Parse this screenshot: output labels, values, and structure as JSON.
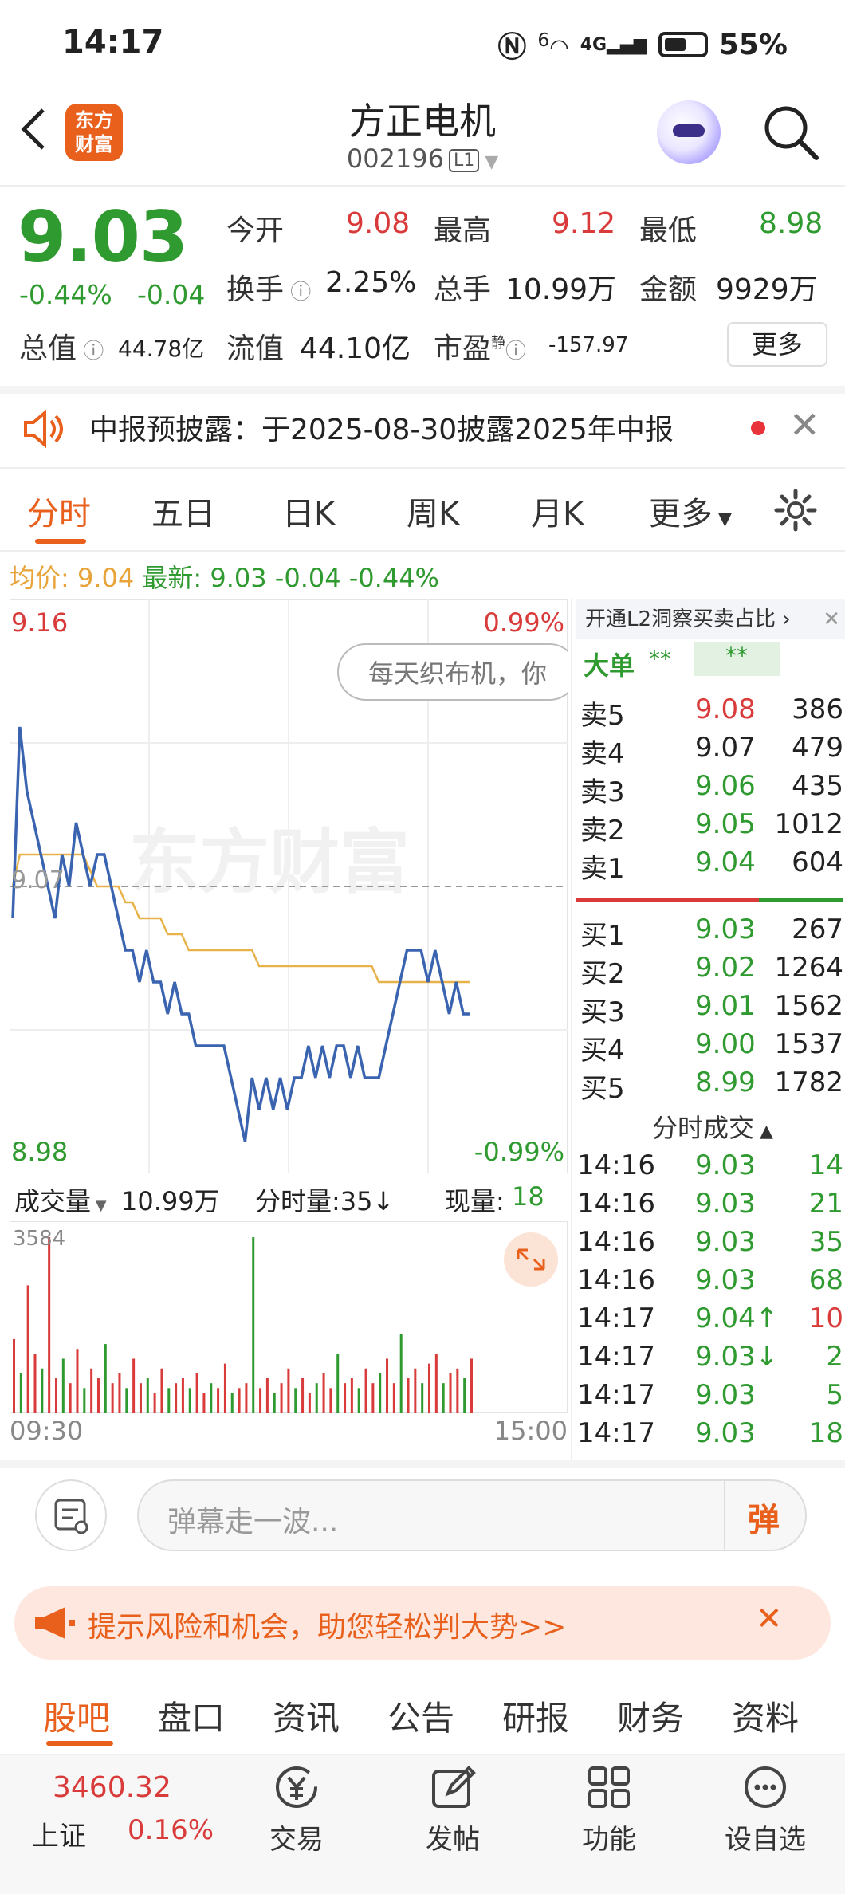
{
  "status_bar": {
    "time": "14:17",
    "signal_label": "6",
    "network": "4G",
    "battery": "55%"
  },
  "header": {
    "back_label": "<",
    "logo_text_1": "东方",
    "logo_text_2": "财富",
    "stock_name": "方正电机",
    "stock_code": "002196",
    "level": "L1"
  },
  "quote": {
    "price": "9.03",
    "change_pct": "-0.44%",
    "change": "-0.04",
    "open_label": "今开",
    "open": "9.08",
    "high_label": "最高",
    "high": "9.12",
    "low_label": "最低",
    "low": "8.98",
    "turnover_label": "换手",
    "turnover": "2.25%",
    "volume_label": "总手",
    "volume": "10.99万",
    "amount_label": "金额",
    "amount": "9929万",
    "mktcap_label": "总值",
    "mktcap": "44.78亿",
    "float_label": "流值",
    "float": "44.10亿",
    "pe_label": "市盈",
    "pe_sup": "静",
    "pe": "-157.97",
    "more_label": "更多"
  },
  "notice": {
    "text": "中报预披露：于2025-08-30披露2025年中报"
  },
  "chart_tabs": [
    "分时",
    "五日",
    "日K",
    "周K",
    "月K",
    "更多"
  ],
  "avg_line": {
    "avg_label": "均价:",
    "avg": "9.04",
    "latest_label": "最新:",
    "latest": "9.03",
    "chg": "-0.04",
    "pct": "-0.44%"
  },
  "chart_labels": {
    "ymax": "9.16",
    "ymin": "8.98",
    "pmax": "0.99%",
    "pmin": "-0.99%",
    "baseline": "9.07",
    "watermark": "东方财富",
    "danmaku": "每天织布机，你"
  },
  "chart_data": {
    "type": "line",
    "ylim": [
      8.98,
      9.16
    ],
    "baseline": 9.07,
    "series": [
      {
        "values": [
          9.06,
          9.12,
          9.1,
          9.09,
          9.08,
          9.07,
          9.06,
          9.08,
          9.07,
          9.09,
          9.08,
          9.07,
          9.08,
          9.08,
          9.07,
          9.06,
          9.05,
          9.05,
          9.04,
          9.05,
          9.04,
          9.04,
          9.03,
          9.04,
          9.03,
          9.03,
          9.02,
          9.02,
          9.02,
          9.02,
          9.02,
          9.01,
          9.0,
          8.99,
          9.01,
          9.0,
          9.01,
          9.0,
          9.01,
          9.0,
          9.01,
          9.01,
          9.02,
          9.01,
          9.02,
          9.01,
          9.02,
          9.02,
          9.01,
          9.02,
          9.01,
          9.01,
          9.01,
          9.02,
          9.03,
          9.04,
          9.05,
          9.05,
          9.05,
          9.04,
          9.05,
          9.04,
          9.03,
          9.04,
          9.03,
          9.03
        ]
      },
      {
        "values": [
          9.07,
          9.08,
          9.08,
          9.08,
          9.08,
          9.08,
          9.08,
          9.08,
          9.08,
          9.08,
          9.08,
          9.075,
          9.07,
          9.07,
          9.07,
          9.07,
          9.065,
          9.065,
          9.06,
          9.06,
          9.06,
          9.06,
          9.055,
          9.055,
          9.055,
          9.05,
          9.05,
          9.05,
          9.05,
          9.05,
          9.05,
          9.05,
          9.05,
          9.05,
          9.05,
          9.045,
          9.045,
          9.045,
          9.045,
          9.045,
          9.045,
          9.045,
          9.045,
          9.045,
          9.045,
          9.045,
          9.045,
          9.045,
          9.045,
          9.045,
          9.045,
          9.045,
          9.04,
          9.04,
          9.04,
          9.04,
          9.04,
          9.04,
          9.04,
          9.04,
          9.04,
          9.04,
          9.04,
          9.04,
          9.04,
          9.04
        ]
      }
    ],
    "volume": {
      "max": "3584",
      "values": [
        1500,
        800,
        2600,
        1200,
        900,
        3584,
        700,
        1100,
        600,
        1300,
        500,
        900,
        700,
        1400,
        600,
        800,
        500,
        1100,
        600,
        700,
        400,
        900,
        500,
        600,
        700,
        500,
        800,
        400,
        600,
        500,
        1000,
        400,
        500,
        600,
        3584,
        500,
        700,
        400,
        600,
        900,
        500,
        700,
        400,
        600,
        800,
        500,
        1200,
        600,
        700,
        500,
        900,
        600,
        800,
        1100,
        600,
        1600,
        700,
        900,
        600,
        1000,
        1200,
        600,
        800,
        900,
        700,
        1100
      ]
    },
    "time_start": "09:30",
    "time_end": "15:00"
  },
  "volume_header": {
    "label": "成交量",
    "total": "10.99万",
    "minute_label": "分时量:35↓",
    "now_label": "现量:",
    "now": "18"
  },
  "side_panel": {
    "banner": "开通L2洞察买卖占比",
    "bigorder_label": "大单",
    "bigorder_v1": "**",
    "bigorder_v2": "**",
    "sells": [
      {
        "label": "卖5",
        "price": "9.08",
        "vol": "386",
        "color": "red"
      },
      {
        "label": "卖4",
        "price": "9.07",
        "vol": "479",
        "color": "black"
      },
      {
        "label": "卖3",
        "price": "9.06",
        "vol": "435",
        "color": "green"
      },
      {
        "label": "卖2",
        "price": "9.05",
        "vol": "1012",
        "color": "green"
      },
      {
        "label": "卖1",
        "price": "9.04",
        "vol": "604",
        "color": "green"
      }
    ],
    "buys": [
      {
        "label": "买1",
        "price": "9.03",
        "vol": "267",
        "color": "green"
      },
      {
        "label": "买2",
        "price": "9.02",
        "vol": "1264",
        "color": "green"
      },
      {
        "label": "买3",
        "price": "9.01",
        "vol": "1562",
        "color": "green"
      },
      {
        "label": "买4",
        "price": "9.00",
        "vol": "1537",
        "color": "green"
      },
      {
        "label": "买5",
        "price": "8.99",
        "vol": "1782",
        "color": "green"
      }
    ],
    "ticks_title": "分时成交",
    "ticks": [
      {
        "time": "14:16",
        "price": "9.03",
        "vol": "14",
        "vcolor": "green"
      },
      {
        "time": "14:16",
        "price": "9.03",
        "vol": "21",
        "vcolor": "green"
      },
      {
        "time": "14:16",
        "price": "9.03",
        "vol": "35",
        "vcolor": "green"
      },
      {
        "time": "14:16",
        "price": "9.03",
        "vol": "68",
        "vcolor": "green"
      },
      {
        "time": "14:17",
        "price": "9.04↑",
        "vol": "10",
        "vcolor": "red"
      },
      {
        "time": "14:17",
        "price": "9.03↓",
        "vol": "2",
        "vcolor": "green"
      },
      {
        "time": "14:17",
        "price": "9.03",
        "vol": "5",
        "vcolor": "green"
      },
      {
        "time": "14:17",
        "price": "9.03",
        "vol": "18",
        "vcolor": "green"
      }
    ]
  },
  "comment": {
    "placeholder": "弹幕走一波...",
    "danmu_btn": "弹"
  },
  "risk_banner": {
    "text": "提示风险和机会，助您轻松判大势>>"
  },
  "bottom_tabs": [
    "股吧",
    "盘口",
    "资讯",
    "公告",
    "研报",
    "财务",
    "资料"
  ],
  "nav": {
    "index_value": "3460.32",
    "index_name": "上证",
    "index_pct": "0.16%",
    "items": [
      "交易",
      "发帖",
      "功能",
      "设自选"
    ]
  },
  "colors": {
    "accent": "#e8601c",
    "up": "#d93a3a",
    "down": "#2f9a2f",
    "avg_line": "#e8b24a",
    "price_line": "#3a64b0"
  }
}
